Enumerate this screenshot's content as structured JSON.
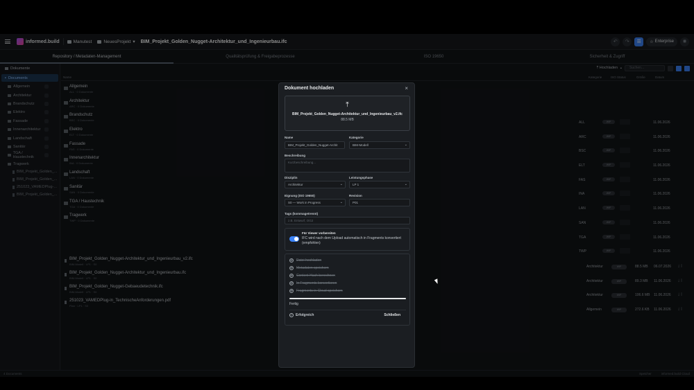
{
  "topbar": {
    "app_name": "informed.build",
    "crumbs": [
      "Manutest",
      "NeuesProjekt"
    ],
    "file_name": "BIM_Projekt_Golden_Nugget-Architektur_und_Ingenieurbau.ifc",
    "plan_label": "Enterprise"
  },
  "tabs": [
    "Repository / Metadaten-Management",
    "Qualitätsprüfung & Freigabeprozesse",
    "ISO 19650",
    "Sicherheit & Zugriff"
  ],
  "sidebar": {
    "header": "Dokumente",
    "root": "Documents",
    "items": [
      "Allgemein",
      "Architektur",
      "Brandschutz",
      "Elektro",
      "Fassade",
      "Innenarchitektur",
      "Landschaft",
      "Sanitär",
      "TGA / Haustechnik",
      "Tragwerk"
    ],
    "files": [
      "BIM_Projekt_Golden_...",
      "BIM_Projekt_Golden_...",
      "251023_VAMEDPlug-...",
      "BIM_Projekt_Golden_..."
    ]
  },
  "toolbar": {
    "upload_label": "Hochladen",
    "search_placeholder": "Suchen..."
  },
  "table_header": {
    "name": "Name",
    "kategorie": "Kategorie",
    "status": "ISO Status",
    "groesse": "Größe",
    "datum": "Datum"
  },
  "folders": [
    {
      "name": "Allgemein",
      "sub": "ALL · 0 Dokumente"
    },
    {
      "name": "Architektur",
      "sub": "ARC · 0 Dokumente"
    },
    {
      "name": "Brandschutz",
      "sub": "BSC · 0 Dokumente"
    },
    {
      "name": "Elektro",
      "sub": "ELT · 0 Dokumente"
    },
    {
      "name": "Fassade",
      "sub": "FAS · 0 Dokumente"
    },
    {
      "name": "Innenarchitektur",
      "sub": "INA · 0 Dokumente"
    },
    {
      "name": "Landschaft",
      "sub": "LAN · 0 Dokumente"
    },
    {
      "name": "Sanitär",
      "sub": "SAN · 0 Dokumente"
    },
    {
      "name": "TGA / Haustechnik",
      "sub": "TGA · 0 Dokumente"
    },
    {
      "name": "Tragwerk",
      "sub": "TWP · 0 Dokumente"
    }
  ],
  "folder_meta": [
    {
      "code": "ALL",
      "pill": "WIP",
      "date": "11.06.2026"
    },
    {
      "code": "ARC",
      "pill": "WIP",
      "date": "11.06.2026"
    },
    {
      "code": "BSC",
      "pill": "WIP",
      "date": "11.06.2026"
    },
    {
      "code": "ELT",
      "pill": "WIP",
      "date": "11.06.2026"
    },
    {
      "code": "FAS",
      "pill": "WIP",
      "date": "11.06.2026"
    },
    {
      "code": "INA",
      "pill": "WIP",
      "date": "11.06.2026"
    },
    {
      "code": "LAN",
      "pill": "WIP",
      "date": "11.06.2026"
    },
    {
      "code": "SAN",
      "pill": "WIP",
      "date": "11.06.2026"
    },
    {
      "code": "TGA",
      "pill": "WIP",
      "date": "11.06.2026"
    },
    {
      "code": "TWP",
      "pill": "WIP",
      "date": "11.06.2026"
    }
  ],
  "files": [
    {
      "name": "BIM_Projekt_Golden_Nugget-Architektur_und_Ingenieurbau_v2.ifc",
      "sub": "BIM-Modell · LP1 · S0",
      "cat": "Architektur",
      "pill": "WIP",
      "size": "88.5 MB",
      "date": "06.07.2026"
    },
    {
      "name": "BIM_Projekt_Golden_Nugget-Architektur_und_Ingenieurbau.ifc",
      "sub": "BIM-Modell · LP1 · S0",
      "cat": "Architektur",
      "pill": "WIP",
      "size": "89.3 MB",
      "date": "11.06.2026"
    },
    {
      "name": "BIM_Projekt_Golden_Nugget-Gebaeudetechnik.ifc",
      "sub": "BIM-Modell · LP1 · S0",
      "cat": "Architektur",
      "pill": "WIP",
      "size": "106.6 MB",
      "date": "11.06.2026"
    },
    {
      "name": "251023_VAMEDPlug-in_TechnischeAnforderungen.pdf",
      "sub": "Plan · LP1 · S0",
      "cat": "Allgemein",
      "pill": "WIP",
      "size": "272.6 KB",
      "date": "11.06.2026"
    }
  ],
  "modal": {
    "title": "Dokument hochladen",
    "file_name": "BIM_Projekt_Golden_Nugget-Architektur_und_Ingenieurbau_v2.ifc",
    "file_size": "88.5 MB",
    "name_label": "Name",
    "name_value": "BIM_Projekt_Golden_Nugget-Archit",
    "category_label": "Kategorie",
    "category_value": "BIM-Modell",
    "description_label": "Beschreibung",
    "description_placeholder": "Kurzbeschreibung...",
    "discipline_label": "Disziplin",
    "discipline_value": "Architektur",
    "phase_label": "Leistungsphase",
    "phase_value": "LP 1",
    "suitability_label": "Eignung (ISO 19650)",
    "suitability_value": "S0 — Work in Progress",
    "revision_label": "Revision",
    "revision_value": "P01",
    "tags_label": "Tags (kommagetrennt)",
    "tags_placeholder": "z.B. Entwurf, OG2",
    "viewer_title": "Für Viewer vorbereiten",
    "viewer_text": "IFC wird nach dem Upload automatisch in Fragments konvertiert (empfohlen)",
    "steps": [
      "Datei hochladen",
      "Metadaten speichern",
      "Content-Hash berechnen",
      "In Fragments konvertieren",
      "Fragments in Cloud speichern"
    ],
    "progress": 1.0,
    "done_label": "Fertig",
    "status_label": "Erfolgreich",
    "close_label": "Schließen"
  },
  "footer": {
    "left": "4 Documents",
    "right": [
      "Speicher",
      "informed.build Cloud"
    ]
  }
}
